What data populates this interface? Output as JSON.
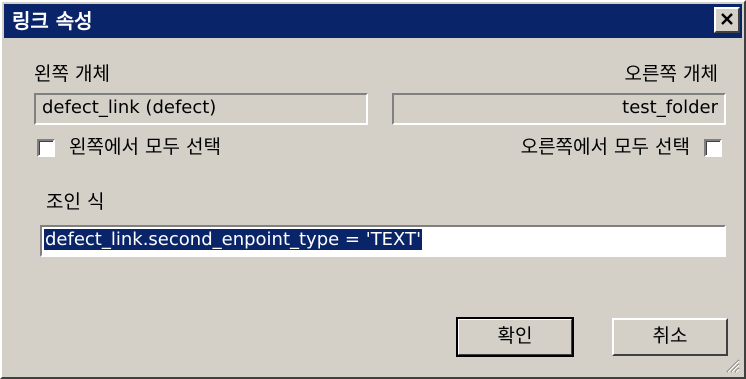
{
  "dialog": {
    "title": "링크 속성",
    "close_icon": "close-icon"
  },
  "left": {
    "label": "왼쪽 개체",
    "value": "defect_link (defect)",
    "select_all_label": "왼쪽에서 모두 선택",
    "select_all_checked": false
  },
  "right": {
    "label": "오른쪽 개체",
    "value": "test_folder",
    "select_all_label": "오른쪽에서 모두 선택",
    "select_all_checked": false
  },
  "join": {
    "label": "조인 식",
    "value": "defect_link.second_enpoint_type = 'TEXT'"
  },
  "buttons": {
    "ok_label": "확인",
    "cancel_label": "취소"
  },
  "colors": {
    "titlebar": "#0a246a",
    "face": "#d4d0c8",
    "selection": "#0a246a"
  }
}
